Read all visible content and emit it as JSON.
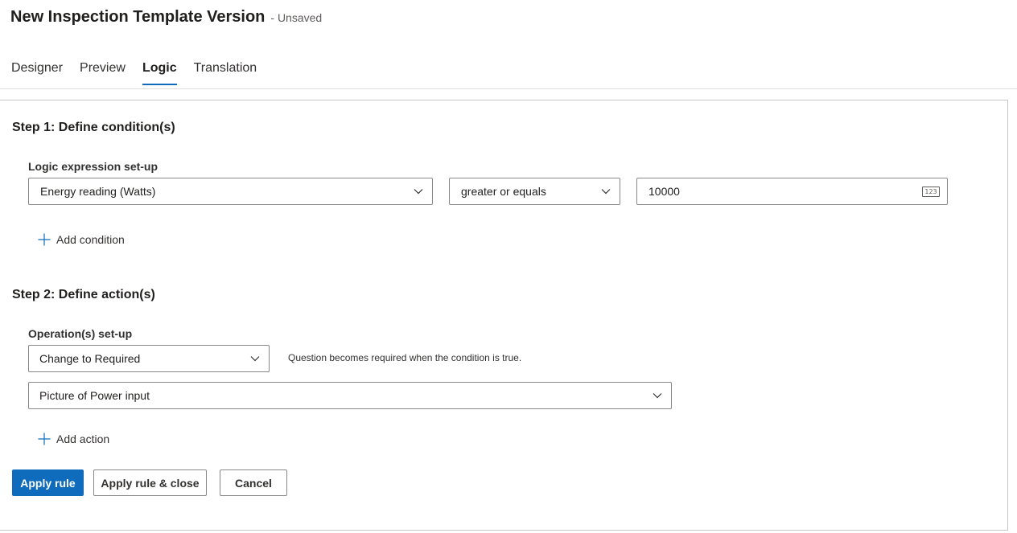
{
  "header": {
    "title": "New Inspection Template Version",
    "status": "- Unsaved"
  },
  "tabs": [
    {
      "label": "Designer",
      "active": false
    },
    {
      "label": "Preview",
      "active": false
    },
    {
      "label": "Logic",
      "active": true
    },
    {
      "label": "Translation",
      "active": false
    }
  ],
  "step1": {
    "heading": "Step 1: Define condition(s)",
    "label": "Logic expression set-up",
    "question": "Energy reading (Watts)",
    "operator": "greater or equals",
    "value": "10000",
    "value_icon": "123",
    "add_label": "Add condition"
  },
  "step2": {
    "heading": "Step 2: Define action(s)",
    "label": "Operation(s) set-up",
    "operation": "Change to Required",
    "helper": "Question becomes required when the condition is true.",
    "target": "Picture of Power input",
    "add_label": "Add action"
  },
  "buttons": {
    "apply": "Apply rule",
    "apply_close": "Apply rule & close",
    "cancel": "Cancel"
  },
  "colors": {
    "accent": "#0f6cbd"
  }
}
